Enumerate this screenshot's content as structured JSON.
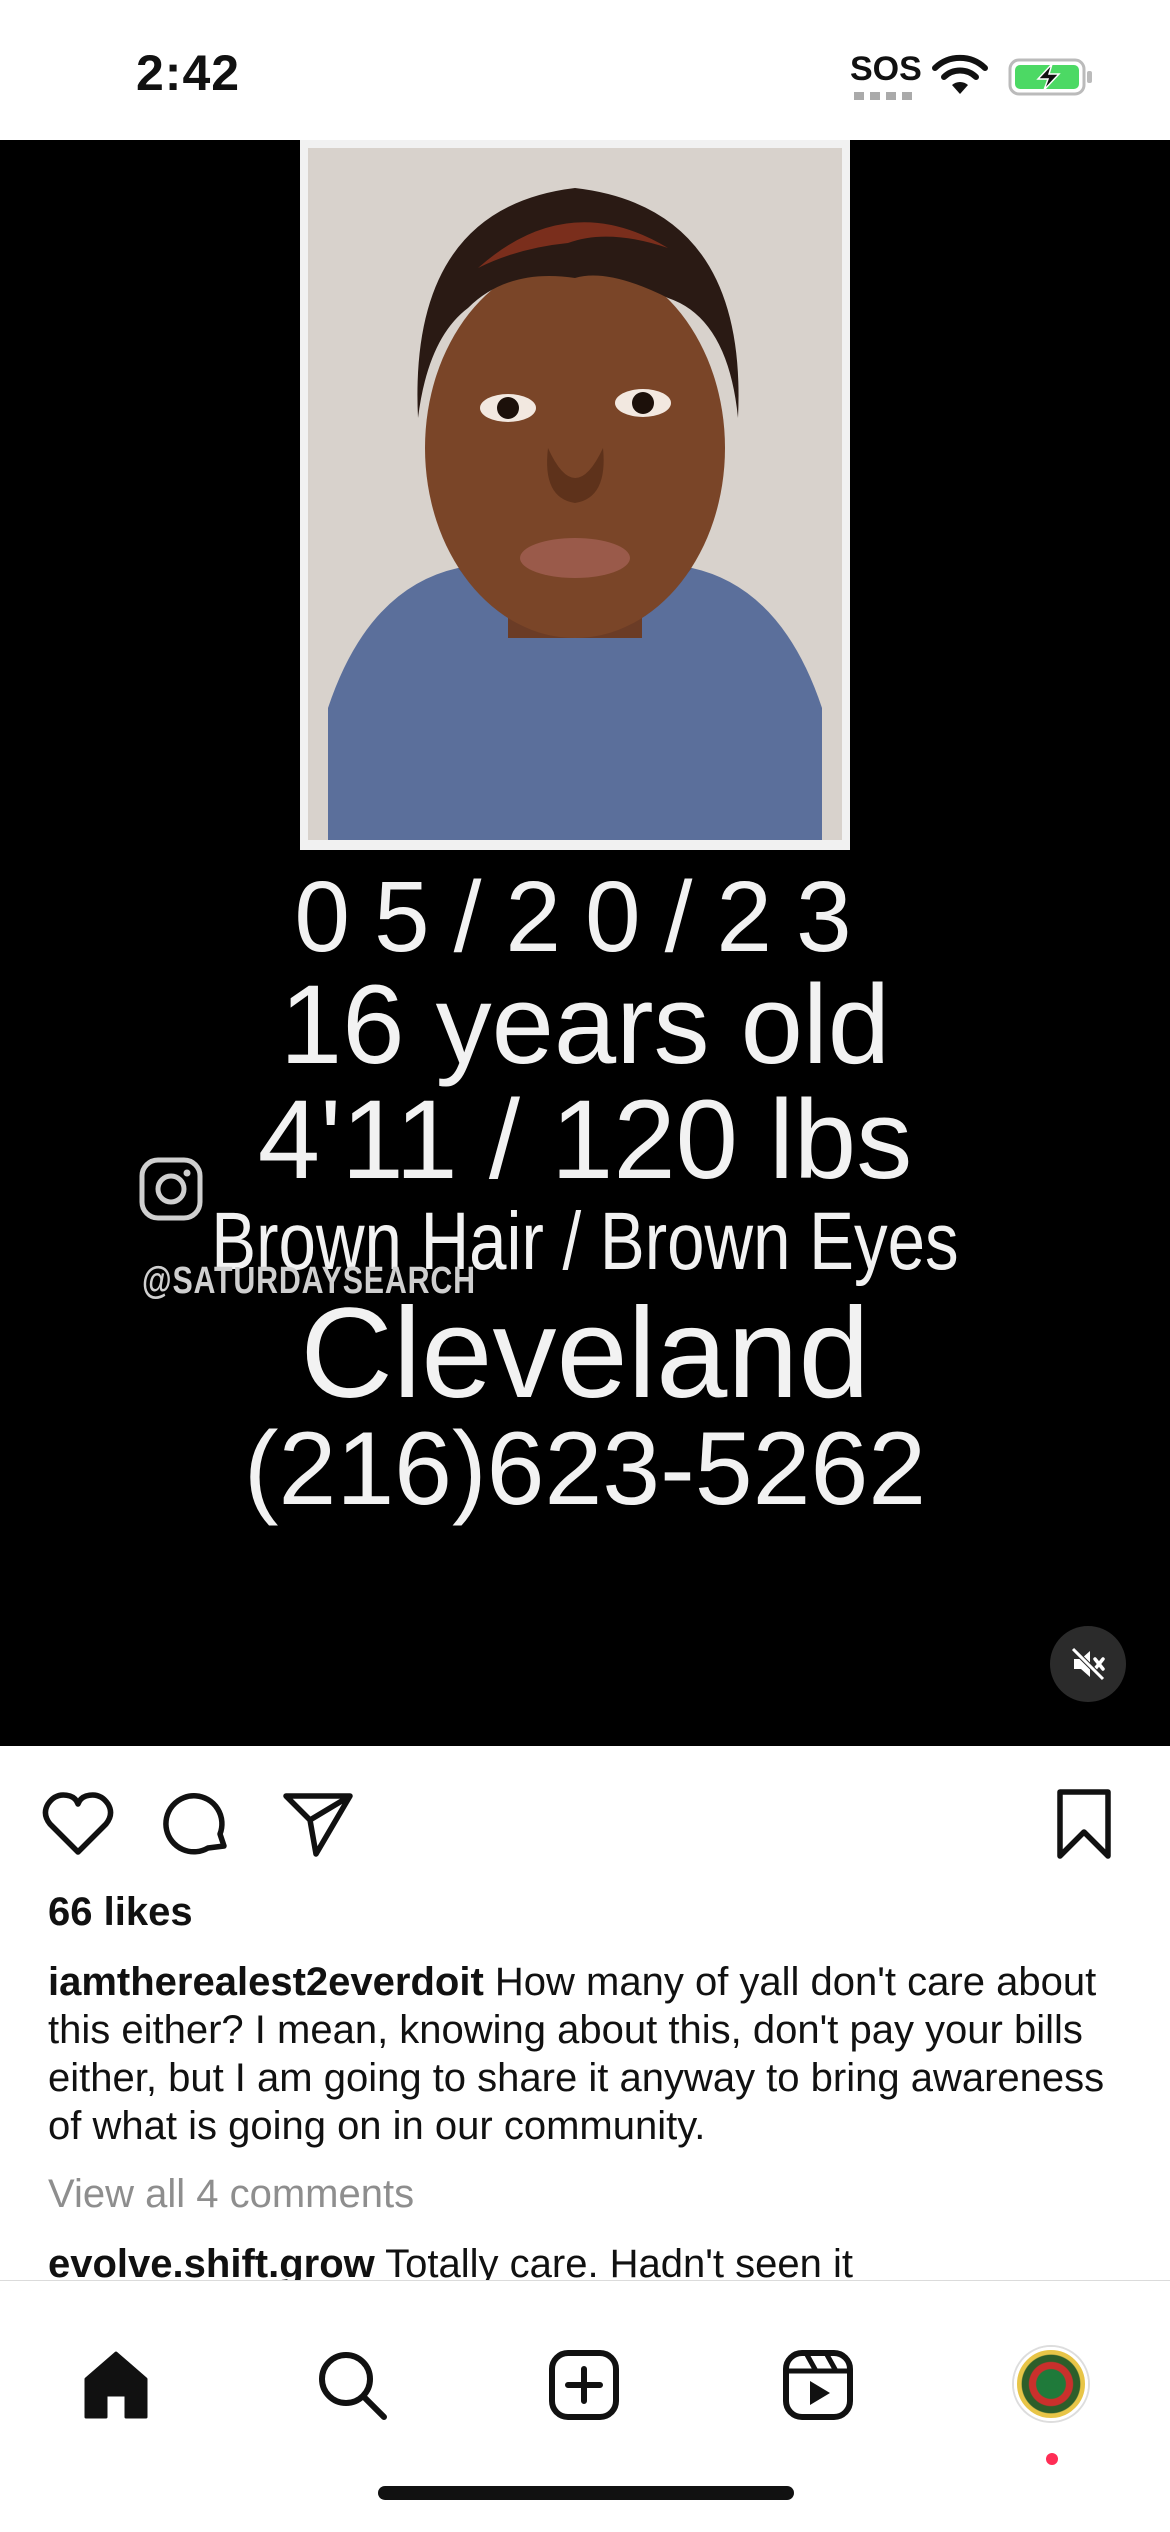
{
  "status_bar": {
    "time": "2:42",
    "sos": "SOS",
    "battery_color": "#4cd964"
  },
  "media": {
    "poster": {
      "date": "05/20/23",
      "age": "16 years old",
      "height_weight": "4'11 / 120 lbs",
      "hair_eyes": "Brown Hair / Brown Eyes",
      "city": "Cleveland",
      "phone": "(216)623-5262"
    },
    "watermark": "@SATURDAYSEARCH",
    "mute_icon": "speaker-muted-icon"
  },
  "post": {
    "likes": "66 likes",
    "username": "iamtherealest2everdoit",
    "caption": "How many of yall don't care about this either? I mean, knowing about this, don't pay your bills either, but I am going to share it anyway to bring awareness of what is going on in our community.",
    "view_comments": "View all 4 comments",
    "comment_user": "evolve.shift.grow",
    "comment_text": "Totally care. Hadn't seen it"
  },
  "icons": {
    "like": "heart-icon",
    "comment": "comment-bubble-icon",
    "share": "paper-plane-icon",
    "save": "bookmark-icon"
  },
  "tabbar": {
    "items": [
      "home",
      "search",
      "create",
      "reels",
      "profile"
    ],
    "notification_color": "#ff2d55"
  }
}
